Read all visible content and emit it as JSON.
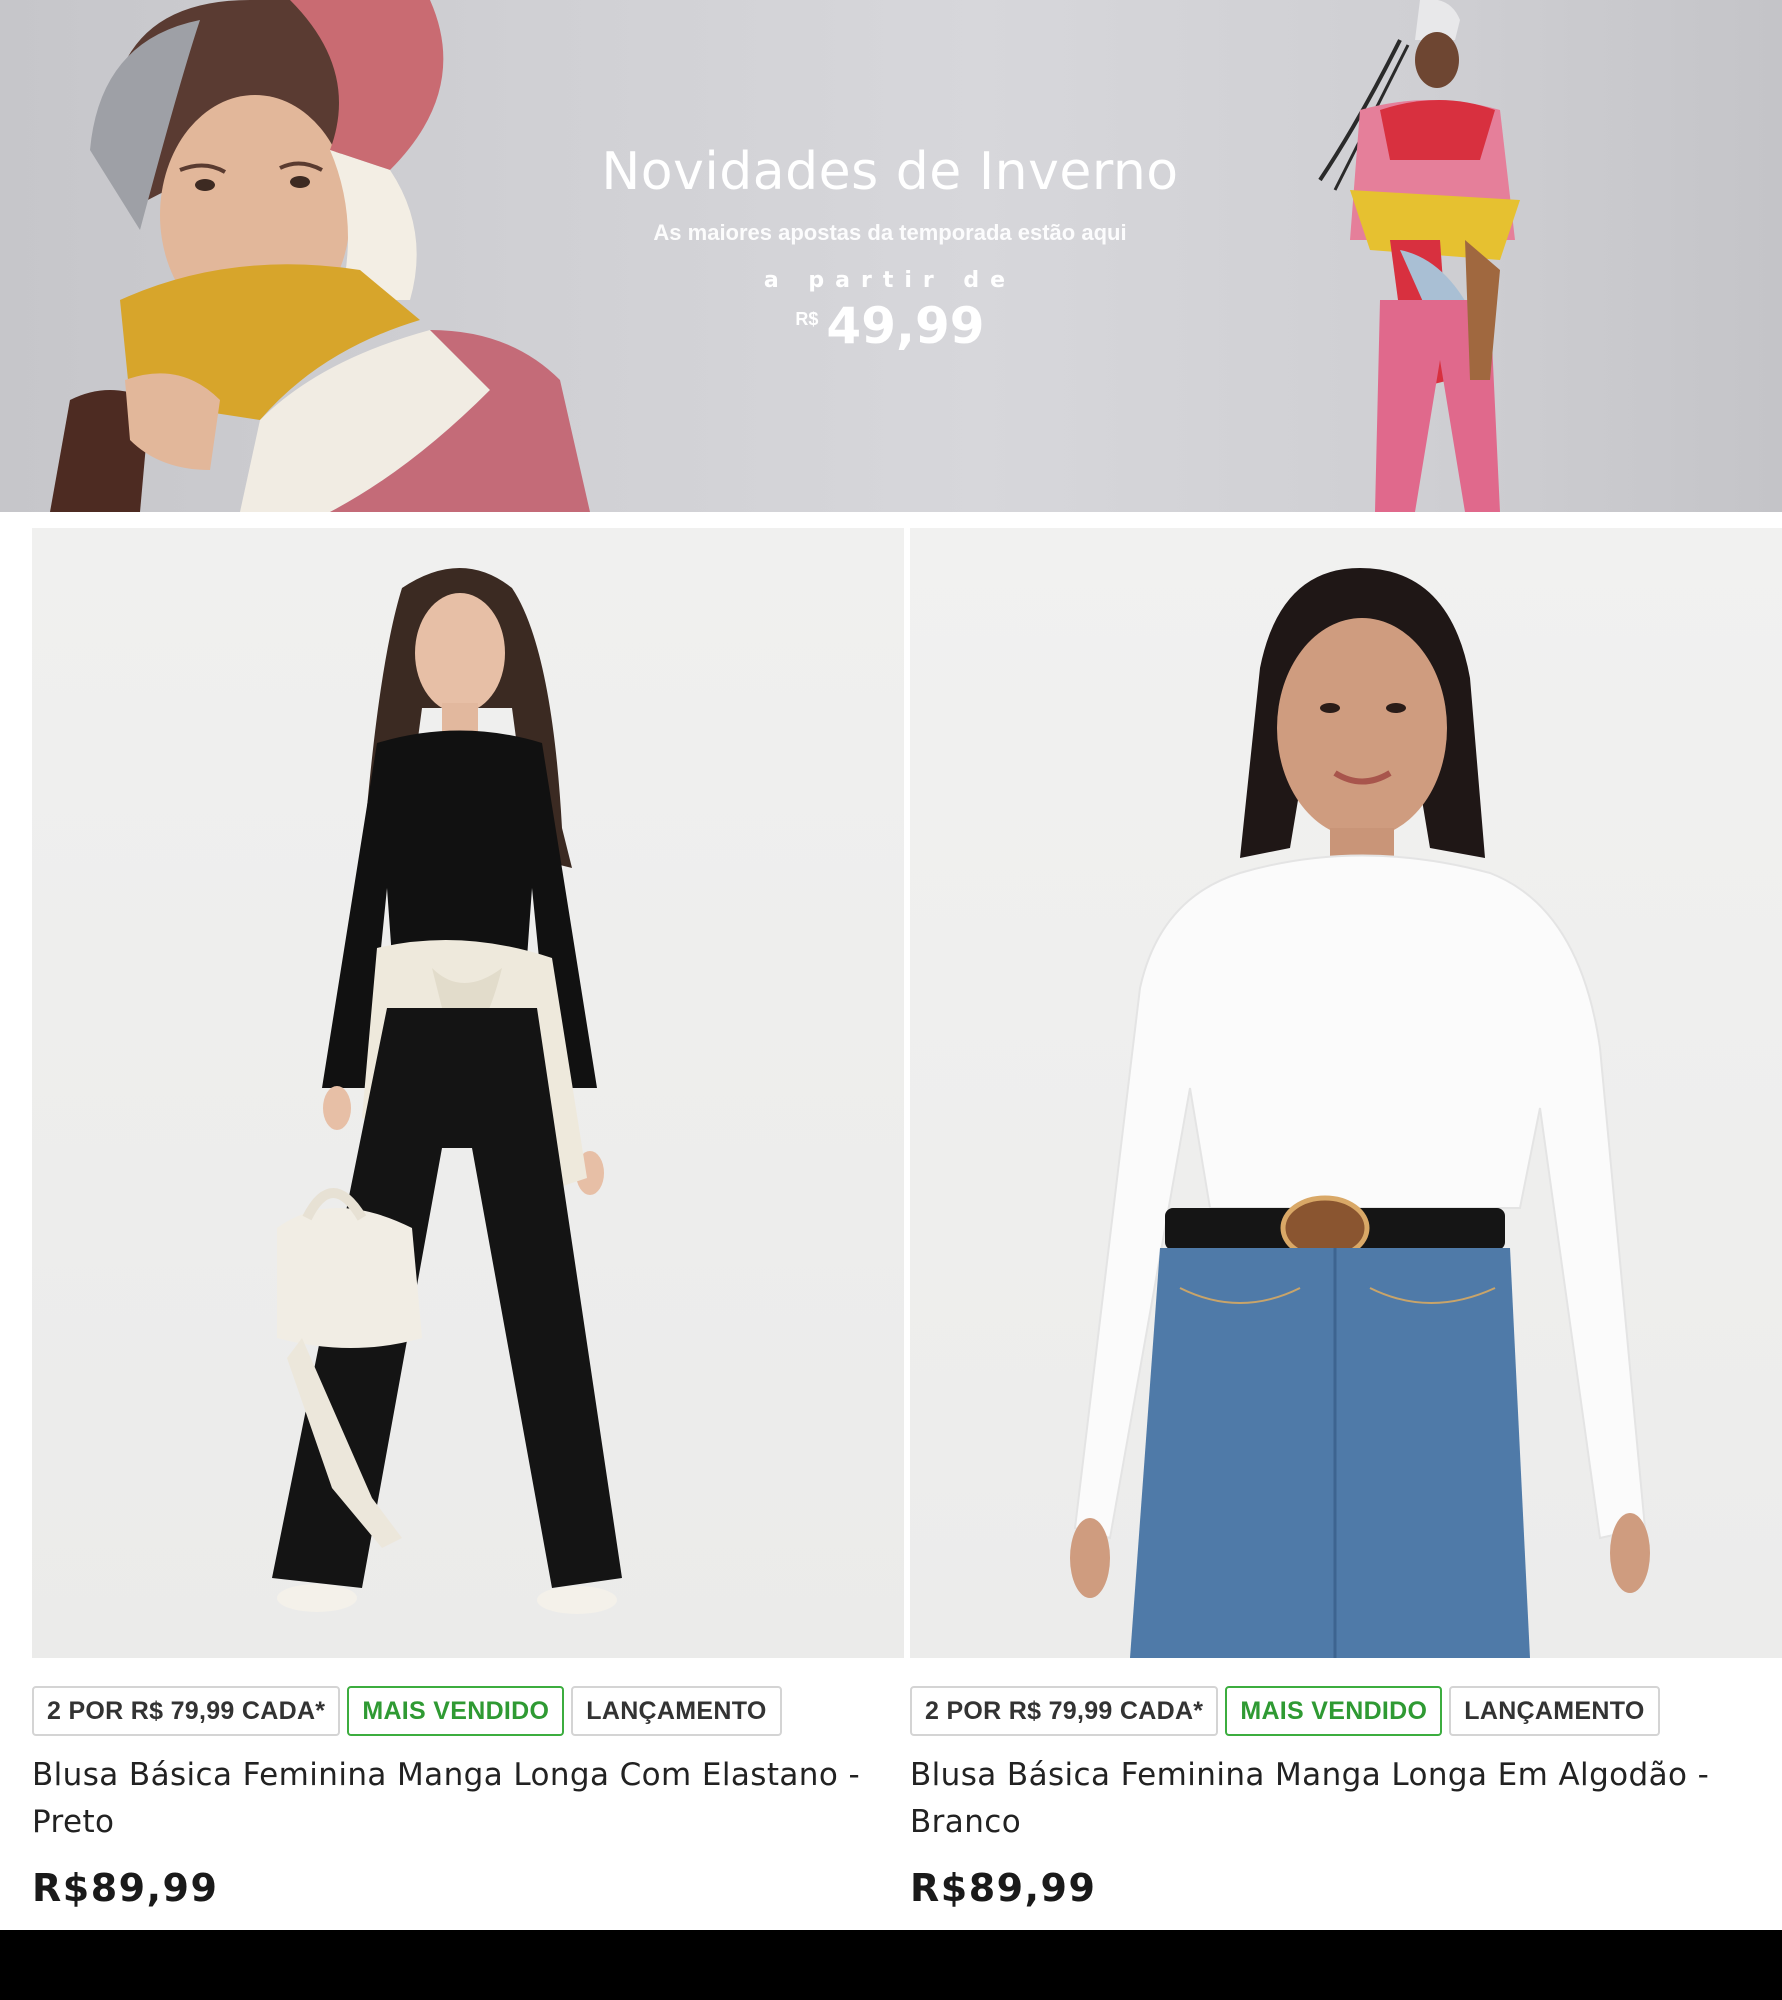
{
  "banner": {
    "title": "Novidades de Inverno",
    "subtitle": "As maiores apostas da temporada estão aqui",
    "from_text": "a partir de",
    "currency": "R$",
    "price": "49,99"
  },
  "products": [
    {
      "badges": [
        "2 POR R$ 79,99 CADA*",
        "MAIS VENDIDO",
        "LANÇAMENTO"
      ],
      "title": "Blusa Básica Feminina Manga Longa Com Elastano - Preto",
      "price": "R$89,99"
    },
    {
      "badges": [
        "2 POR R$ 79,99 CADA*",
        "MAIS VENDIDO",
        "LANÇAMENTO"
      ],
      "title": "Blusa Básica Feminina Manga Longa Em Algodão - Branco",
      "price": "R$89,99"
    }
  ],
  "colors": {
    "badge_green": "#3cad3f",
    "badge_border": "#d4d4d4",
    "text_dark": "#222222"
  }
}
